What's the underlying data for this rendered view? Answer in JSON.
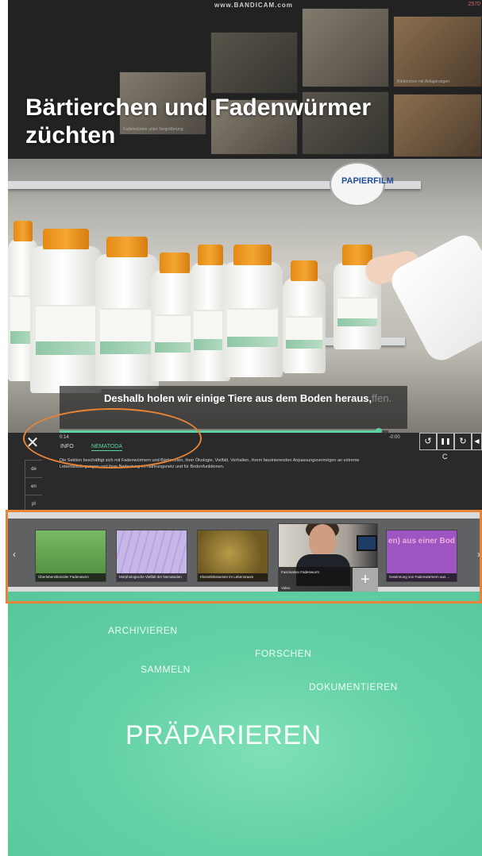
{
  "watermark": {
    "text": "www.BANDICAM.com",
    "counter": "2570"
  },
  "header": {
    "title_line1": "Bärtierchen und Fadenwürmer",
    "title_line2": "züchten",
    "tile_captions": [
      "Bärtierchen mit Ablagerungen",
      "Fadenwürmer unter Vergrößerung"
    ]
  },
  "video": {
    "brand": "PAPIERFILM",
    "subtitle": "Deshalb holen wir einige Tiere aus dem Boden heraus,",
    "subtitle_tail": "ffen.",
    "progress_fraction": 0.97
  },
  "player": {
    "close": "✕",
    "time_current": "0:14",
    "time_total": "-0:00",
    "tabs": [
      "INFO",
      "NEMATODA"
    ],
    "description": "Die Sektion beschäftigt sich mit Fadenwürmern und Bärtierchen, ihrer Ökologie, Vielfalt, Verhalten, ihrem faszinierenden Anpassungsvermögen an extreme Lebensbedingungen und ihrer Bedeutung im Nahrungsnetz und für Bodenfunktionen.",
    "languages": [
      "de",
      "en",
      "pl"
    ],
    "controls": {
      "replay": "↺",
      "pause": "❚❚",
      "forward": "↻",
      "volume": "◀"
    },
    "caption_toggle": "C"
  },
  "gallery": {
    "items": [
      {
        "caption": "Überlebenskünstler Fadenwurm"
      },
      {
        "caption": "Morphologische Vielfalt der Nematoden"
      },
      {
        "caption": "Kleinstlebewesen im Lebensraum"
      },
      {
        "caption": "Faszination Fadenwurm",
        "subcaption": "Video"
      },
      {
        "caption": "Gewinnung von Fadenwürmern aus ...",
        "overlay_text": "en) aus einer Bod"
      }
    ],
    "add_label": "+",
    "prev": "‹",
    "next": "›"
  },
  "bottom": {
    "words": [
      "ARCHIVIEREN",
      "FORSCHEN",
      "SAMMELN",
      "DOKUMENTIEREN",
      "PRÄPARIEREN"
    ]
  }
}
